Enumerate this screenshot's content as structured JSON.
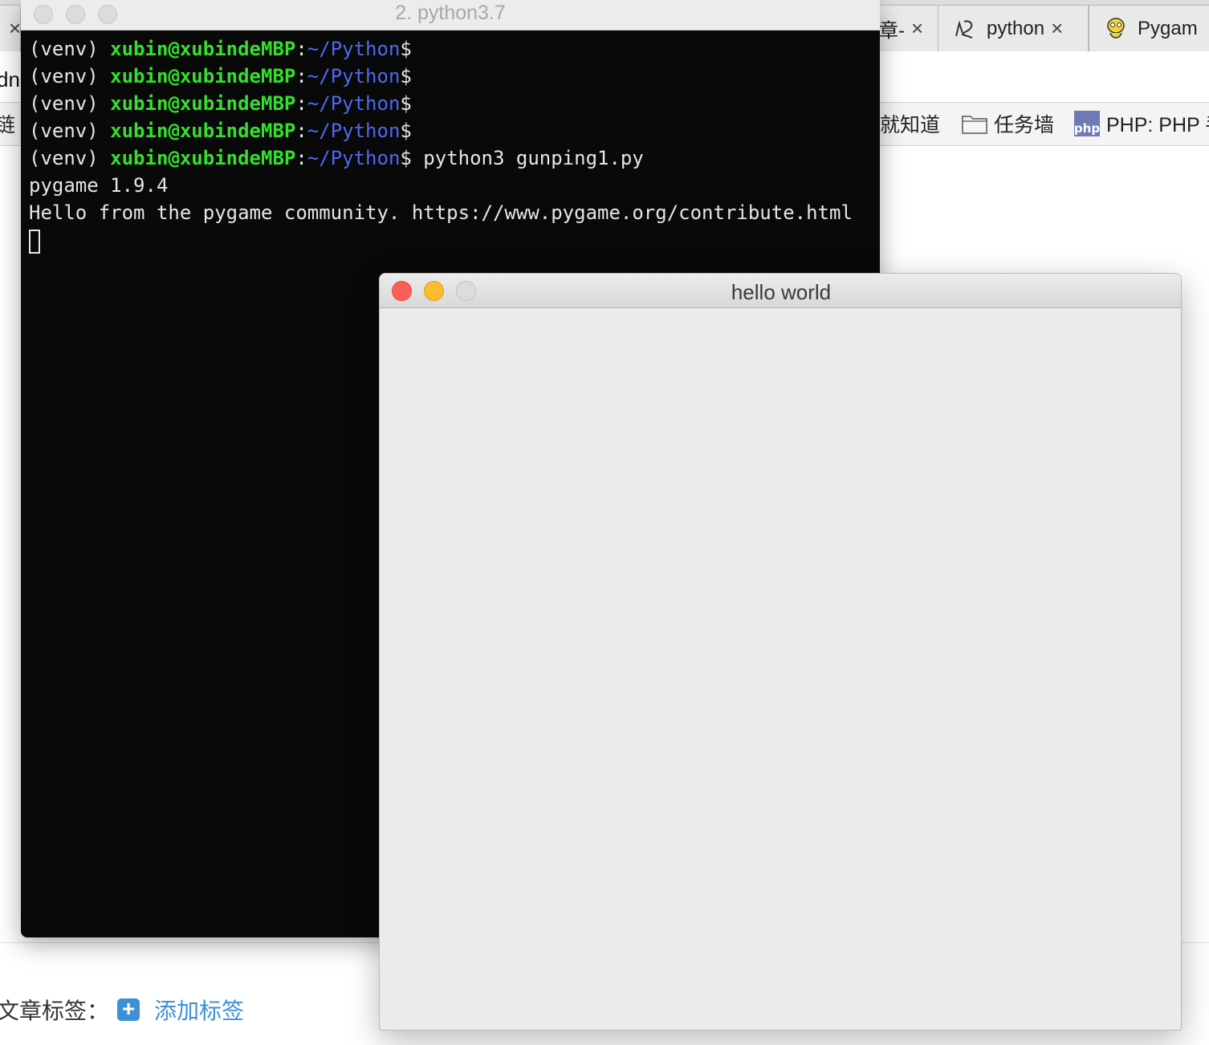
{
  "browser": {
    "tabs": [
      {
        "label": "",
        "close": "×"
      },
      {
        "label": "章-",
        "close": "×"
      },
      {
        "label": "python",
        "close": "×"
      },
      {
        "label": "Pygam",
        "close": ""
      }
    ],
    "url_fragment": "dn.",
    "bookmarks": [
      {
        "label": "链"
      },
      {
        "label": "就知道"
      },
      {
        "label": "任务墙"
      },
      {
        "label": "PHP: PHP 手",
        "icon_text": "php"
      }
    ],
    "page": {
      "tags_label": "文章标签：",
      "add_tag_label": "添加标签",
      "add_tag_icon": "+"
    }
  },
  "terminal": {
    "title": "2. python3.7",
    "prompt": {
      "venv": "(venv) ",
      "user_host": "xubin@xubindeMBP",
      "sep": ":",
      "path": "~/Python",
      "dollar": "$"
    },
    "empty_prompt_count": 4,
    "command": " python3 gunping1.py",
    "output": [
      "pygame 1.9.4",
      "Hello from the pygame community. https://www.pygame.org/contribute.html"
    ]
  },
  "pygame_window": {
    "title": "hello world",
    "background": "#ebebeb"
  },
  "colors": {
    "terminal_bg": "#090909",
    "prompt_user": "#34e02c",
    "prompt_path": "#4f68f0",
    "close_red": "#fc5f57",
    "minimize_yellow": "#fdbc2e",
    "link_blue": "#3d8fd6"
  }
}
